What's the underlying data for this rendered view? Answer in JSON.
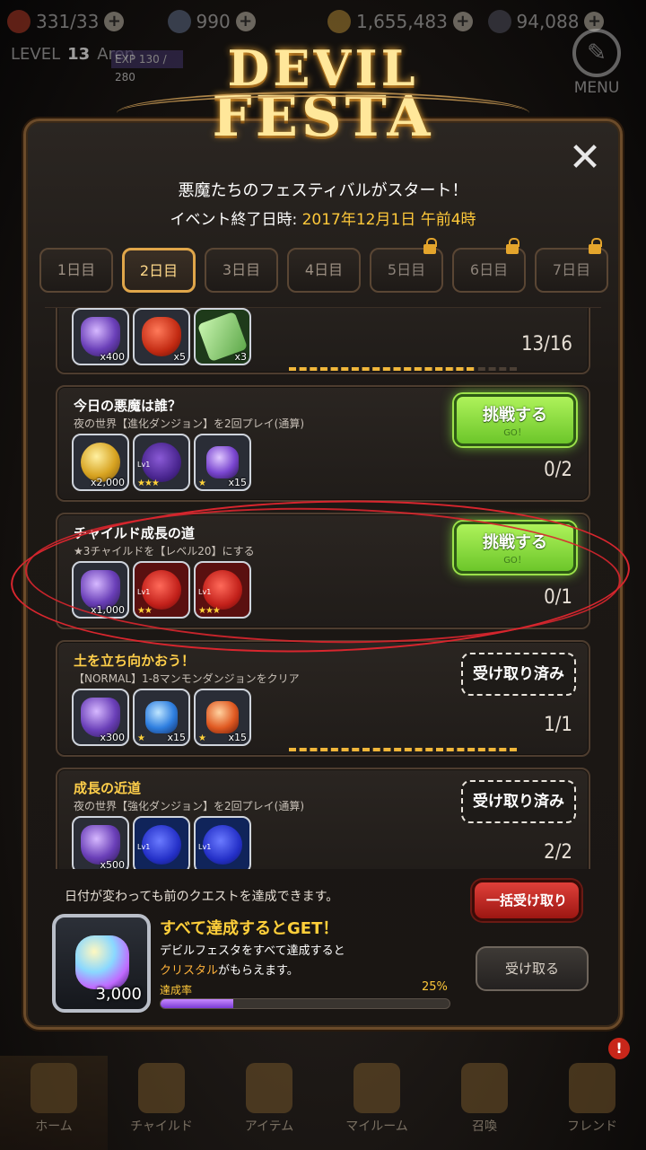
{
  "top_bar": {
    "resources": [
      {
        "icon": "heart-icon",
        "value": "331/33"
      },
      {
        "icon": "stone-icon",
        "value": "990"
      },
      {
        "icon": "coin-icon",
        "value": "1,655,483"
      },
      {
        "icon": "crystal-icon",
        "value": "94,088"
      }
    ],
    "level_label": "LEVEL",
    "level_value": "13",
    "player_name": "Aren",
    "exp": "EXP 130 / 280",
    "menu_label": "MENU"
  },
  "event": {
    "logo_line1": "DEVIL",
    "logo_line2": "FESTA",
    "headline": "悪魔たちのフェスティバルがスタート！",
    "deadline_label": "イベント終了日時: ",
    "deadline_value": "2017年12月1日 午前4時"
  },
  "tabs": [
    {
      "label": "1日目",
      "locked": false,
      "active": false
    },
    {
      "label": "2日目",
      "locked": false,
      "active": true
    },
    {
      "label": "3日目",
      "locked": false,
      "active": false
    },
    {
      "label": "4日目",
      "locked": false,
      "active": false
    },
    {
      "label": "5日目",
      "locked": true,
      "active": false
    },
    {
      "label": "6日目",
      "locked": true,
      "active": false
    },
    {
      "label": "7日目",
      "locked": true,
      "active": false
    }
  ],
  "quests": [
    {
      "title": "",
      "desc": "",
      "items": [
        {
          "icon": "crystal-icon",
          "qty": "x400"
        },
        {
          "icon": "heart-icon",
          "qty": "x5"
        },
        {
          "icon": "ticket-icon",
          "qty": "x3"
        }
      ],
      "progress": "13/16",
      "progress_fraction": 0.8125,
      "button": ""
    },
    {
      "title": "今日の悪魔は誰？",
      "desc": "夜の世界【進化ダンジョン】を2回プレイ(通算)",
      "items": [
        {
          "icon": "gold-coins-icon",
          "qty": "x2,000"
        },
        {
          "icon": "purple-child-icon",
          "qty": "",
          "stars": "★★★",
          "lv": "Lv1"
        },
        {
          "icon": "purple-gem-icon",
          "qty": "x15",
          "stars": "★"
        }
      ],
      "progress": "0/2",
      "progress_fraction": 0,
      "button": {
        "label": "挑戦する",
        "sub": "GO！"
      }
    },
    {
      "title": "チャイルド成長の道",
      "desc": "★3チャイルドを【レベル20】にする",
      "items": [
        {
          "icon": "crystal-icon",
          "qty": "x1,000"
        },
        {
          "icon": "red-child-icon",
          "qty": "",
          "stars": "★★",
          "lv": "Lv1"
        },
        {
          "icon": "red-child-icon",
          "qty": "",
          "stars": "★★★",
          "lv": "Lv1"
        }
      ],
      "progress": "0/1",
      "progress_fraction": 0,
      "button": {
        "label": "挑戦する",
        "sub": "GO！"
      }
    },
    {
      "title": "土を立ち向かおう！",
      "desc": "【NORMAL】1-8マンモンダンジョンをクリア",
      "items": [
        {
          "icon": "crystal-icon",
          "qty": "x300"
        },
        {
          "icon": "blue-gem-icon",
          "qty": "x15",
          "stars": "★"
        },
        {
          "icon": "red-gem-icon",
          "qty": "x15",
          "stars": "★"
        }
      ],
      "progress": "1/1",
      "progress_fraction": 1,
      "button": {
        "label": "受け取り済み"
      }
    },
    {
      "title": "成長の近道",
      "desc": "夜の世界【強化ダンジョン】を2回プレイ(通算)",
      "items": [
        {
          "icon": "crystal-icon",
          "qty": "x500"
        },
        {
          "icon": "blue-child-icon",
          "qty": "",
          "lv": "Lv1"
        },
        {
          "icon": "blue-child-icon",
          "qty": "",
          "lv": "Lv1"
        }
      ],
      "progress": "2/2",
      "progress_fraction": 1,
      "button": {
        "label": "受け取り済み"
      }
    }
  ],
  "footer": {
    "note": "日付が変わっても前のクエストを達成できます。",
    "bulk_button": "一括受け取り",
    "reward_qty": "3,000",
    "reward_title": "すべて達成するとGET！",
    "reward_desc1": "デビルフェスタをすべて達成すると",
    "reward_desc2_highlight": "クリスタル",
    "reward_desc2_rest": "がもらえます。",
    "receive_button": "受け取る",
    "rate_label": "達成率",
    "rate_value": "25%",
    "rate_fraction": 0.25
  },
  "bottom_nav": [
    {
      "label": "ホーム",
      "icon": "home-icon"
    },
    {
      "label": "チャイルド",
      "icon": "child-icon"
    },
    {
      "label": "アイテム",
      "icon": "item-icon"
    },
    {
      "label": "マイルーム",
      "icon": "crown-icon"
    },
    {
      "label": "召喚",
      "icon": "summon-icon"
    },
    {
      "label": "フレンド",
      "icon": "shield-icon"
    }
  ],
  "nav_badge": "!",
  "colors": {
    "accent_gold": "#ffc93a",
    "challenge_green": "#8ee03a",
    "bulk_red": "#c8261a",
    "annotation_red": "#d8262e"
  }
}
